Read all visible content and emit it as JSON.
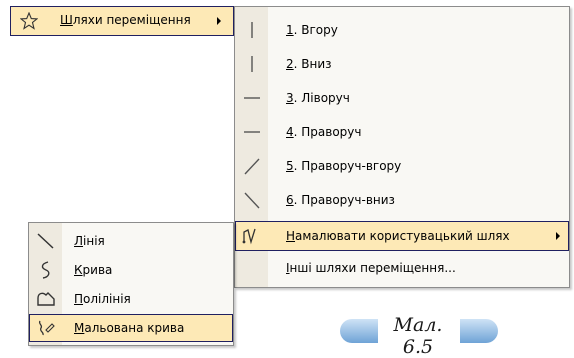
{
  "top_menu": {
    "label_hotkey": "Ш",
    "label_rest": "ляхи переміщення",
    "icon": "star-outline-icon"
  },
  "submenu": {
    "items": [
      {
        "hotkey": "1",
        "rest": ". Вгору",
        "icon": "line-up-icon"
      },
      {
        "hotkey": "2",
        "rest": ". Вниз",
        "icon": "line-down-icon"
      },
      {
        "hotkey": "3",
        "rest": ". Ліворуч",
        "icon": "line-left-icon"
      },
      {
        "hotkey": "4",
        "rest": ". Праворуч",
        "icon": "line-right-icon"
      },
      {
        "hotkey": "5",
        "rest": ". Праворуч-вгору",
        "icon": "line-up-right-icon"
      },
      {
        "hotkey": "6",
        "rest": ". Праворуч-вниз",
        "icon": "line-down-right-icon"
      }
    ],
    "draw_custom": {
      "hotkey": "Н",
      "rest": "амалювати користувацький шлях",
      "icon": "custom-path-icon"
    },
    "other": {
      "hotkey": "І",
      "rest": "нші шляхи переміщення..."
    }
  },
  "draw_menu": {
    "items": [
      {
        "hotkey": "Л",
        "rest": "інія",
        "icon": "line-tool-icon"
      },
      {
        "hotkey": "К",
        "rest": "рива",
        "icon": "curve-tool-icon"
      },
      {
        "hotkey": "П",
        "rest": "олілінія",
        "icon": "polyline-tool-icon"
      },
      {
        "hotkey": "М",
        "rest": "альована крива",
        "icon": "freeform-tool-icon"
      }
    ]
  },
  "caption": "Мал. 6.5"
}
